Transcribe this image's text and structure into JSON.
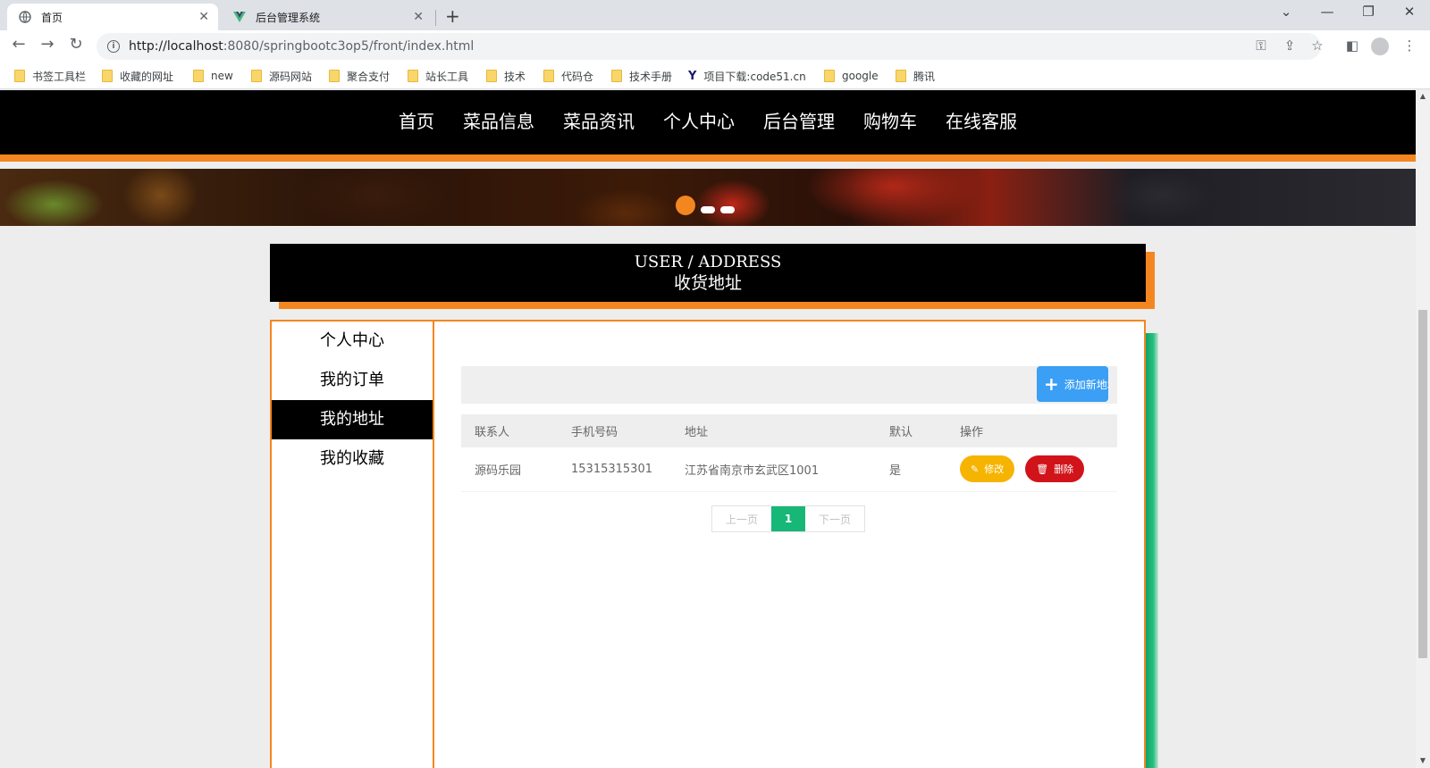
{
  "browser": {
    "tabs": [
      {
        "title": "首页",
        "active": true,
        "icon": "globe-icon"
      },
      {
        "title": "后台管理系统",
        "active": false,
        "icon": "vue-logo-icon"
      }
    ],
    "new_tab": "+",
    "url_host": "http://localhost",
    "url_path": ":8080/springbootc3op5/front/index.html",
    "bookmarks": [
      {
        "label": "书签工具栏"
      },
      {
        "label": "收藏的网址"
      },
      {
        "label": "new"
      },
      {
        "label": "源码网站"
      },
      {
        "label": "聚合支付"
      },
      {
        "label": "站长工具"
      },
      {
        "label": "技术"
      },
      {
        "label": "代码仓"
      },
      {
        "label": "技术手册"
      },
      {
        "label": "项目下载:code51.cn",
        "logo": "Y"
      },
      {
        "label": "google"
      },
      {
        "label": "腾讯"
      }
    ]
  },
  "nav": {
    "items": [
      "首页",
      "菜品信息",
      "菜品资讯",
      "个人中心",
      "后台管理",
      "购物车",
      "在线客服"
    ]
  },
  "title": {
    "en": "USER / ADDRESS",
    "zh": "收货地址"
  },
  "sidebar": {
    "items": [
      {
        "label": "个人中心",
        "active": false
      },
      {
        "label": "我的订单",
        "active": false
      },
      {
        "label": "我的地址",
        "active": true
      },
      {
        "label": "我的收藏",
        "active": false
      }
    ]
  },
  "toolbar": {
    "add_label": "添加新地址"
  },
  "table": {
    "headers": [
      "联系人",
      "手机号码",
      "地址",
      "默认",
      "操作"
    ],
    "rows": [
      {
        "contact": "源码乐园",
        "phone": "15315315301",
        "address": "江苏省南京市玄武区1001",
        "default": "是",
        "edit": "修改",
        "delete": "删除"
      }
    ]
  },
  "pager": {
    "prev": "上一页",
    "current": "1",
    "next": "下一页"
  },
  "colors": {
    "accent_orange": "#f4861f",
    "nav_black": "#000000",
    "add_blue": "#3a9ff5",
    "edit_yellow": "#f6b400",
    "delete_red": "#d0141a",
    "pager_green": "#16b777"
  }
}
